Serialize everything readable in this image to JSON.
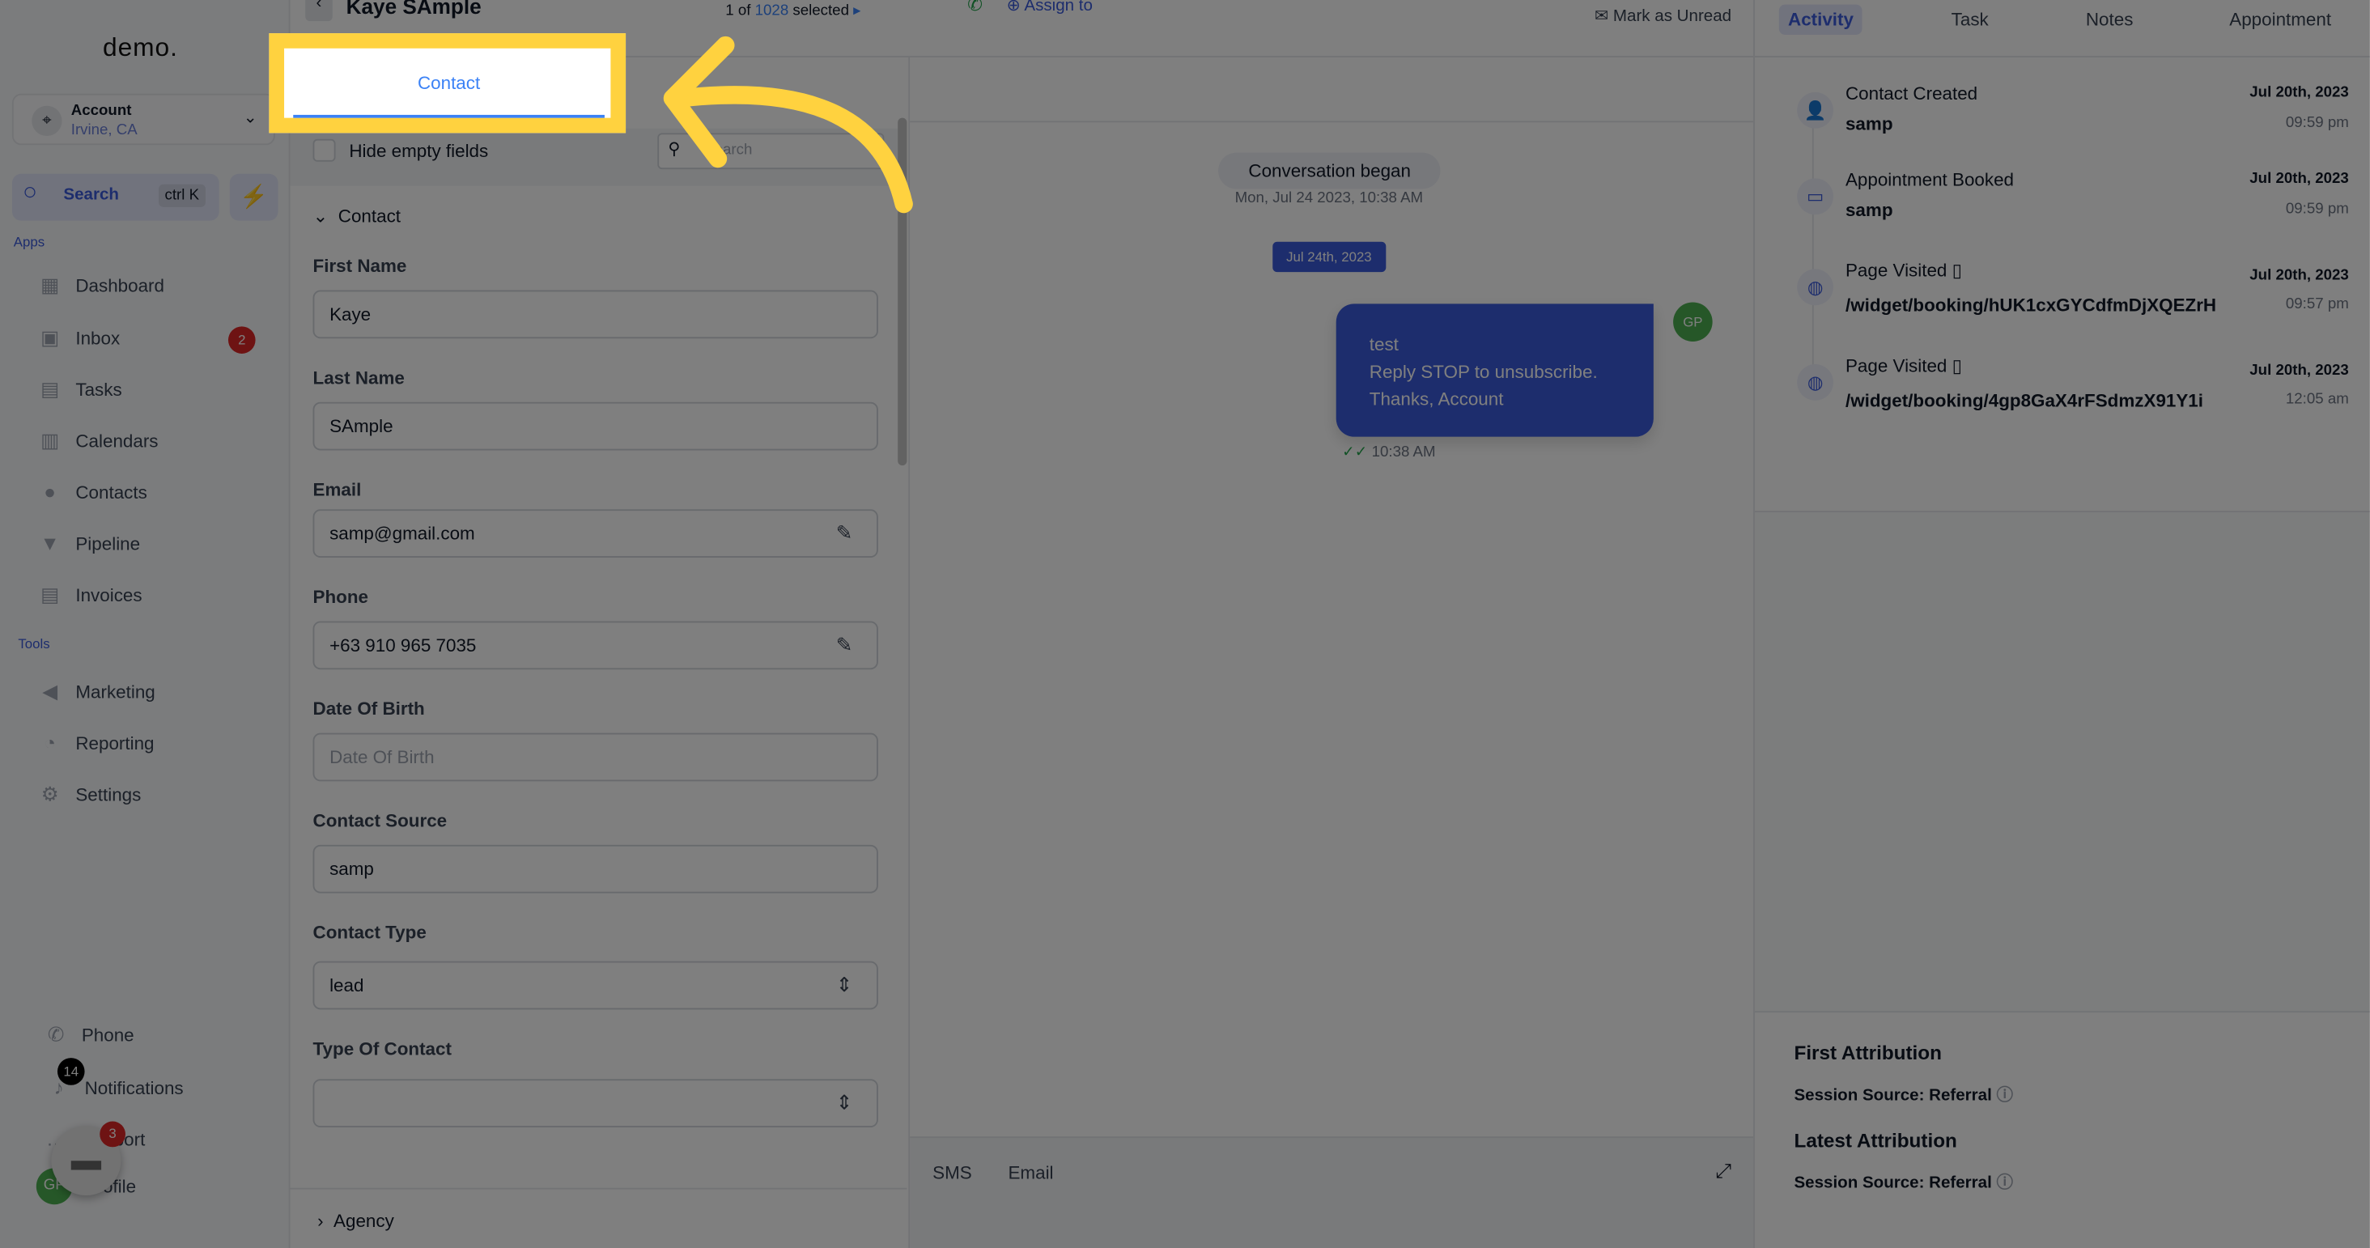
{
  "sidebar": {
    "logo": "demo.",
    "account": {
      "name": "Account",
      "location": "Irvine, CA"
    },
    "search": {
      "label": "Search",
      "shortcut": "ctrl K"
    },
    "apps_heading": "Apps",
    "apps": [
      {
        "label": "Dashboard",
        "icon": "grid-icon"
      },
      {
        "label": "Inbox",
        "icon": "inbox-icon",
        "badge": "2"
      },
      {
        "label": "Tasks",
        "icon": "clipboard-icon"
      },
      {
        "label": "Calendars",
        "icon": "calendar-icon"
      },
      {
        "label": "Contacts",
        "icon": "person-icon"
      },
      {
        "label": "Pipeline",
        "icon": "funnel-icon"
      },
      {
        "label": "Invoices",
        "icon": "invoice-icon"
      }
    ],
    "tools_heading": "Tools",
    "tools": [
      {
        "label": "Marketing",
        "icon": "megaphone-icon"
      },
      {
        "label": "Reporting",
        "icon": "pie-chart-icon"
      },
      {
        "label": "Settings",
        "icon": "gear-icon"
      }
    ],
    "bottom": {
      "phone": "Phone",
      "notifications": "Notifications",
      "notifications_badge": "14",
      "support": "Support",
      "support_badge": "3",
      "profile": "Profile",
      "avatar": "GP"
    }
  },
  "header": {
    "contact_name": "Kaye SAmple",
    "pager_prefix": "1 of",
    "pager_total": "1028",
    "pager_suffix": "selected",
    "assign": "Assign to",
    "mark_unread": "Mark as Unread"
  },
  "contact_panel": {
    "active_tab": "Contact",
    "hide_empty": "Hide empty fields",
    "search_placeholder": "Search",
    "section": "Contact",
    "fields": [
      {
        "label": "First Name",
        "value": "Kaye"
      },
      {
        "label": "Last Name",
        "value": "SAmple"
      },
      {
        "label": "Email",
        "value": "samp@gmail.com"
      },
      {
        "label": "Phone",
        "value": "+63 910 965 7035"
      },
      {
        "label": "Date Of Birth",
        "placeholder": "Date Of Birth"
      },
      {
        "label": "Contact Source",
        "value": "samp"
      },
      {
        "label": "Contact Type",
        "value": "lead"
      },
      {
        "label": "Type Of Contact",
        "value": ""
      }
    ],
    "next_section": "Agency"
  },
  "conversation": {
    "began": "Conversation began",
    "began_time": "Mon, Jul 24 2023, 10:38 AM",
    "date_chip": "Jul 24th, 2023",
    "message": [
      "test",
      "Reply STOP to unsubscribe.",
      "Thanks, Account"
    ],
    "message_time": "10:38 AM",
    "avatar": "GP",
    "compose_tabs": [
      "SMS",
      "Email"
    ]
  },
  "right_panel": {
    "tabs": [
      "Activity",
      "Task",
      "Notes",
      "Appointment"
    ],
    "active_tab": "Activity",
    "activities": [
      {
        "title": "Contact Created",
        "detail": "samp",
        "date": "Jul 20th, 2023",
        "time": "09:59 pm",
        "icon": "person-add-icon"
      },
      {
        "title": "Appointment Booked",
        "detail": "samp",
        "date": "Jul 20th, 2023",
        "time": "09:59 pm",
        "icon": "calendar-icon"
      },
      {
        "title": "Page Visited",
        "detail": "/widget/booking/hUK1cxGYCdfmDjXQEZrH",
        "date": "Jul 20th, 2023",
        "time": "09:57 pm",
        "icon": "globe-icon"
      },
      {
        "title": "Page Visited",
        "detail": "/widget/booking/4gp8GaX4rFSdmzX91Y1i",
        "date": "Jul 20th, 2023",
        "time": "12:05 am",
        "icon": "globe-icon"
      }
    ],
    "first_attribution": "First Attribution",
    "first_source": "Session Source: Referral",
    "latest_attribution": "Latest Attribution",
    "latest_source": "Session Source: Referral"
  },
  "colors": {
    "accent": "#3b82f6",
    "highlight": "#ffd23f",
    "bubble": "#3b5bdb"
  }
}
